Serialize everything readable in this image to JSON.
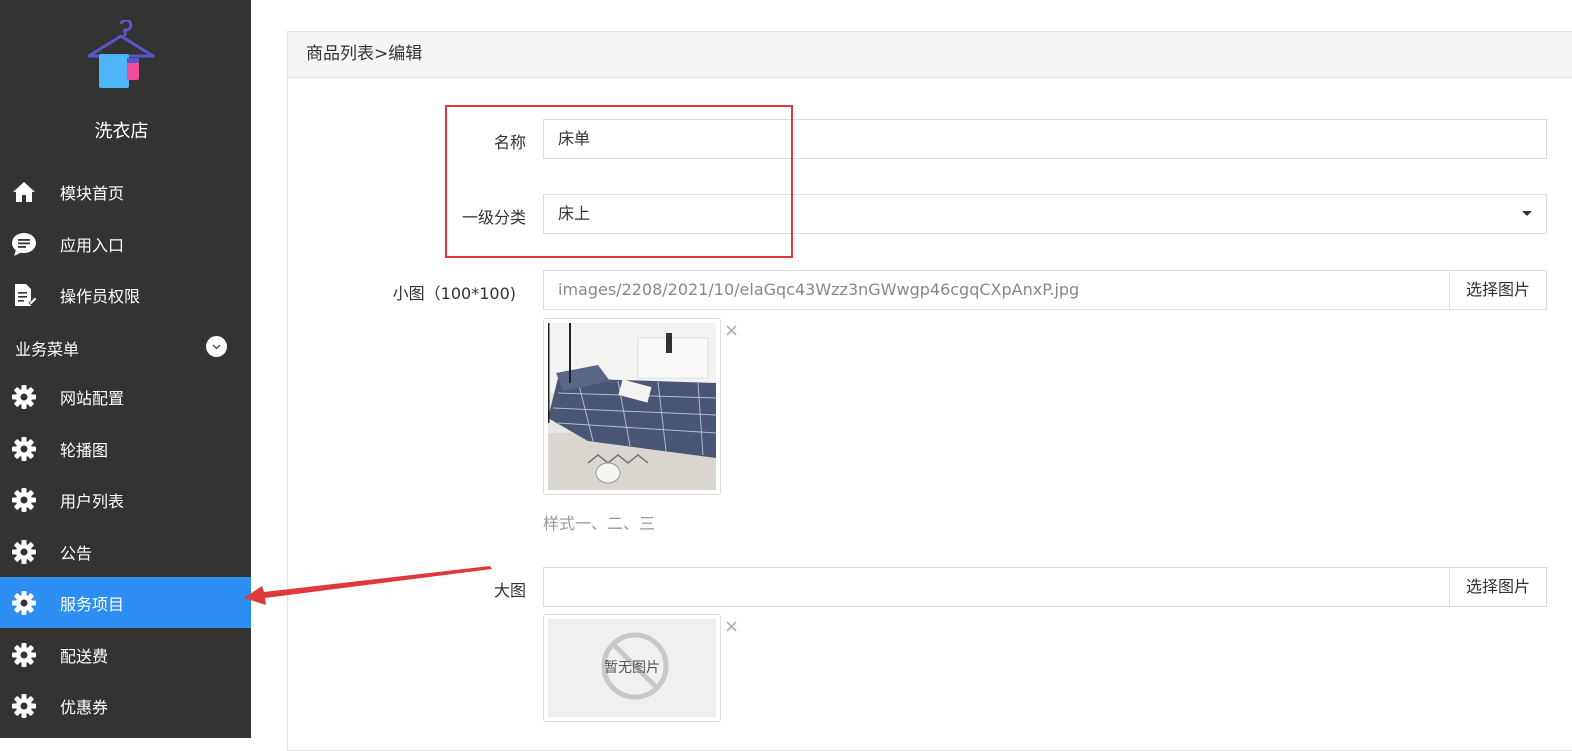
{
  "sidebar": {
    "shop_name": "洗衣店",
    "nav_top": [
      {
        "label": "模块首页",
        "icon": "home-icon"
      },
      {
        "label": "应用入口",
        "icon": "chat-bubble-icon"
      },
      {
        "label": "操作员权限",
        "icon": "document-edit-icon"
      }
    ],
    "group_title": "业务菜单",
    "nav_biz": [
      {
        "label": "网站配置",
        "icon": "gear-icon"
      },
      {
        "label": "轮播图",
        "icon": "gear-icon"
      },
      {
        "label": "用户列表",
        "icon": "gear-icon"
      },
      {
        "label": "公告",
        "icon": "gear-icon"
      },
      {
        "label": "服务项目",
        "icon": "gear-icon",
        "active": true
      },
      {
        "label": "配送费",
        "icon": "gear-icon"
      },
      {
        "label": "优惠券",
        "icon": "gear-icon"
      }
    ],
    "active_color": "#2c8df3",
    "bg_color": "#333333"
  },
  "breadcrumb": "商品列表>编辑",
  "form": {
    "name_label": "名称",
    "name_value": "床单",
    "category_label": "一级分类",
    "category_value": "床上",
    "small_image_label": "小图（100*100)",
    "small_image_path": "images/2208/2021/10/elaGqc43Wzz3nGWwgp46cgqCXpAnxP.jpg",
    "small_image_button": "选择图片",
    "small_image_hint": "样式一、二、三",
    "large_image_label": "大图",
    "large_image_path": "",
    "large_image_button": "选择图片",
    "no_image_text": "暂无图片",
    "remove_symbol": "×"
  },
  "annotation_color": "#e0393b"
}
